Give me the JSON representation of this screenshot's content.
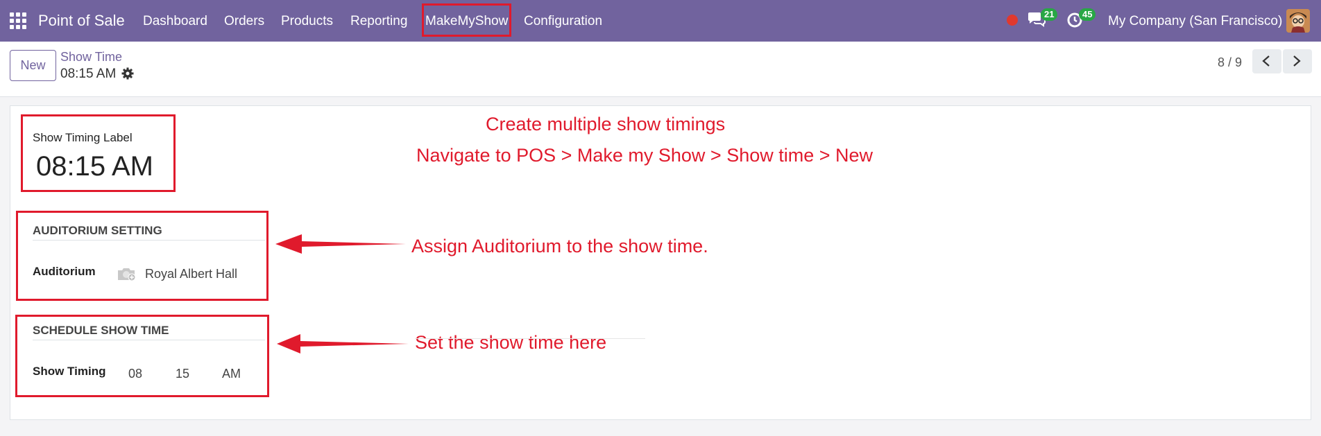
{
  "navbar": {
    "app_name": "Point of Sale",
    "menu": [
      "Dashboard",
      "Orders",
      "Products",
      "Reporting",
      "MakeMyShow",
      "Configuration"
    ],
    "messages_badge": "21",
    "activities_badge": "45",
    "company": "My Company (San Francisco)"
  },
  "control": {
    "new_label": "New",
    "breadcrumb_parent": "Show Time",
    "breadcrumb_current": "08:15 AM",
    "pager": "8 / 9"
  },
  "form": {
    "timing_label_title": "Show Timing Label",
    "timing_label_value": "08:15 AM",
    "auditorium_section": "AUDITORIUM SETTING",
    "auditorium_label": "Auditorium",
    "auditorium_value": "Royal Albert Hall",
    "schedule_section": "SCHEDULE SHOW TIME",
    "show_timing_label": "Show Timing",
    "hour": "08",
    "minute": "15",
    "ampm": "AM"
  },
  "annotations": {
    "line1": "Create multiple show timings",
    "line2": "Navigate to POS > Make my Show > Show time > New",
    "auditorium_note": "Assign Auditorium to the show time.",
    "schedule_note": "Set the show time here"
  },
  "colors": {
    "navbar": "#71639e",
    "annotation": "#e01a2c",
    "badge": "#28a745"
  }
}
